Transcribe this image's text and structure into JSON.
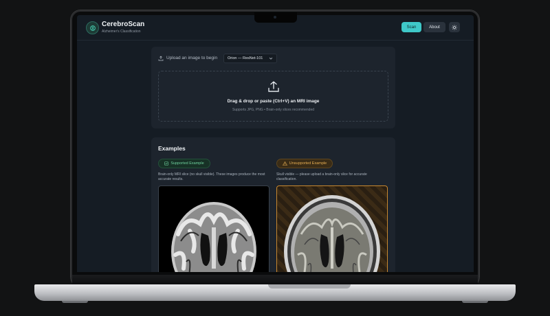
{
  "app": {
    "title": "CerebroScan",
    "subtitle": "Alzheimer's Classification"
  },
  "header": {
    "scan_label": "Scan",
    "about_label": "About"
  },
  "upload": {
    "label": "Upload an image to begin",
    "model_selected": "Orion — ResNet-101",
    "drop_title": "Drag & drop or paste (Ctrl+V) an MRI image",
    "drop_subtitle": "Supports JPG, PNG • Brain-only slices recommended"
  },
  "examples": {
    "title": "Examples",
    "supported": {
      "badge": "Supported Example",
      "description": "Brain-only MRI slice (no skull visible). These images produce the most accurate results."
    },
    "unsupported": {
      "badge": "Unsupported Example",
      "description": "Skull visible — please upload a brain-only slice for accurate classification."
    }
  },
  "colors": {
    "accent": "#3fc8c8",
    "supported": "#6fd19e",
    "unsupported": "#e6ae53"
  },
  "icons": [
    "brain-logo-icon",
    "sun-icon",
    "upload-icon",
    "chevron-down-icon",
    "check-circle-icon",
    "warning-triangle-icon"
  ]
}
